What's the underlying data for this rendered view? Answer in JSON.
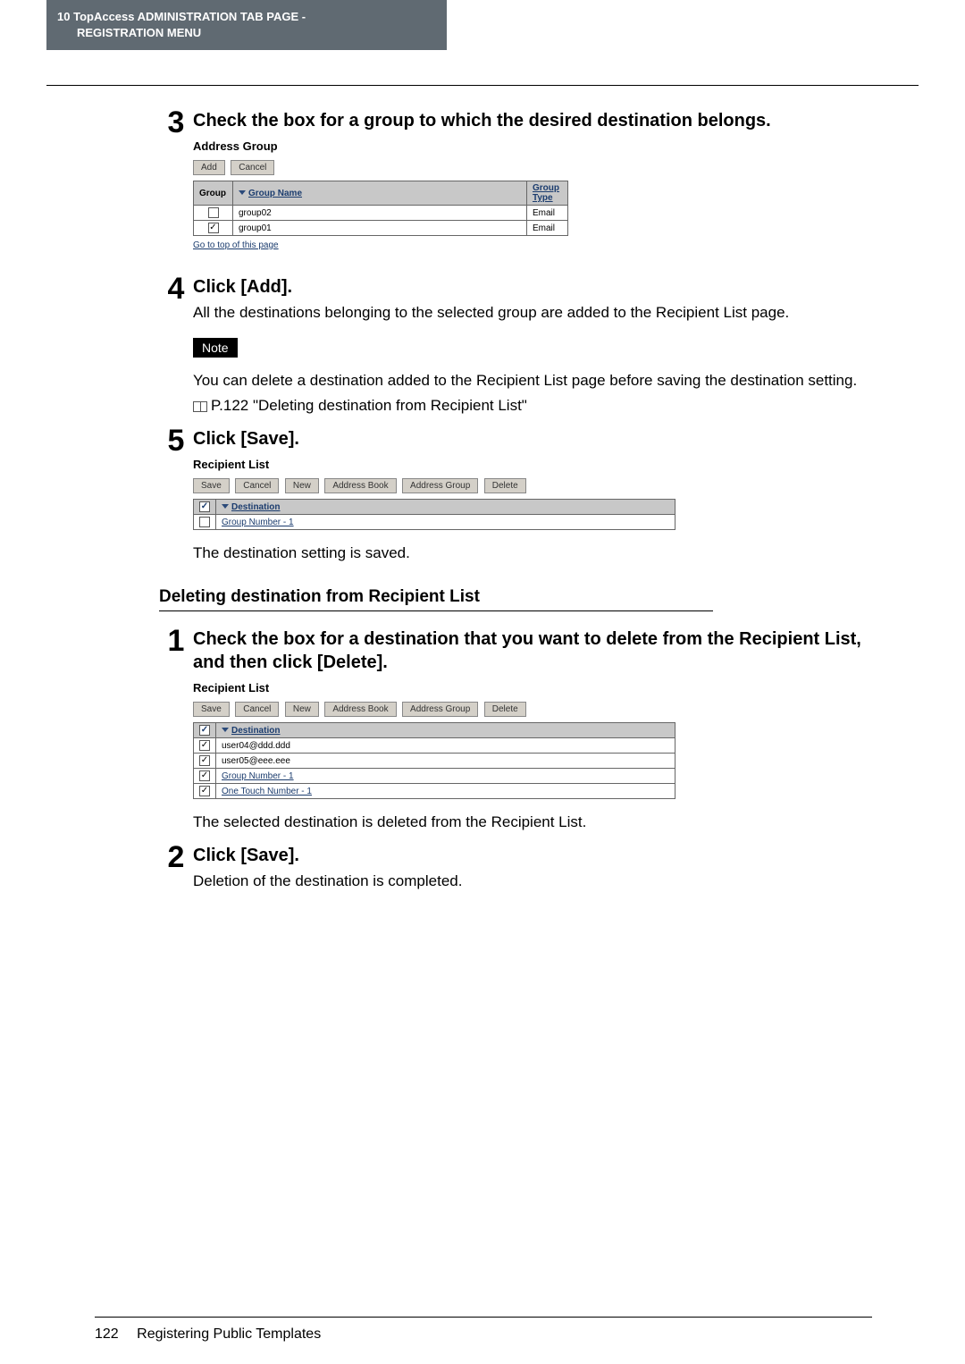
{
  "header": {
    "chapter": "10",
    "title_top": "TopAccess ADMINISTRATION TAB PAGE -",
    "title_sub": "REGISTRATION MENU"
  },
  "step3": {
    "num": "3",
    "title": "Check the box for a group to which the desired destination belongs.",
    "shot_title": "Address Group",
    "btn_add": "Add",
    "btn_cancel": "Cancel",
    "col_group": "Group",
    "col_name": "Group Name",
    "col_type": "Group Type",
    "rows": [
      {
        "checked": false,
        "name": "group02",
        "type": "Email"
      },
      {
        "checked": true,
        "name": "group01",
        "type": "Email"
      }
    ],
    "go_top": "Go to top of this page"
  },
  "step4": {
    "num": "4",
    "title": "Click [Add].",
    "body": "All the destinations belonging to the selected group are added to the Recipient List page.",
    "note_label": "Note",
    "note_body": "You can delete a destination added to the Recipient List page before saving the destination setting.",
    "ref": "P.122 \"Deleting destination from Recipient List\""
  },
  "step5": {
    "num": "5",
    "title": "Click [Save].",
    "shot_title": "Recipient List",
    "btn_save": "Save",
    "btn_cancel": "Cancel",
    "btn_new": "New",
    "btn_ab": "Address Book",
    "btn_ag": "Address Group",
    "btn_del": "Delete",
    "col_dest": "Destination",
    "row1": "Group Number - 1",
    "body": "The destination setting is saved."
  },
  "subheading": "Deleting destination from Recipient List",
  "del_step1": {
    "num": "1",
    "title": "Check the box for a destination that you want to delete from the Recipient List, and then click [Delete].",
    "shot_title": "Recipient List",
    "btn_save": "Save",
    "btn_cancel": "Cancel",
    "btn_new": "New",
    "btn_ab": "Address Book",
    "btn_ag": "Address Group",
    "btn_del": "Delete",
    "col_dest": "Destination",
    "rows": [
      "user04@ddd.ddd",
      "user05@eee.eee",
      "Group Number - 1",
      "One Touch Number - 1"
    ],
    "body": "The selected destination is deleted from the Recipient List."
  },
  "del_step2": {
    "num": "2",
    "title": "Click [Save].",
    "body": "Deletion of the destination is completed."
  },
  "footer": {
    "page": "122",
    "label": "Registering Public Templates"
  }
}
